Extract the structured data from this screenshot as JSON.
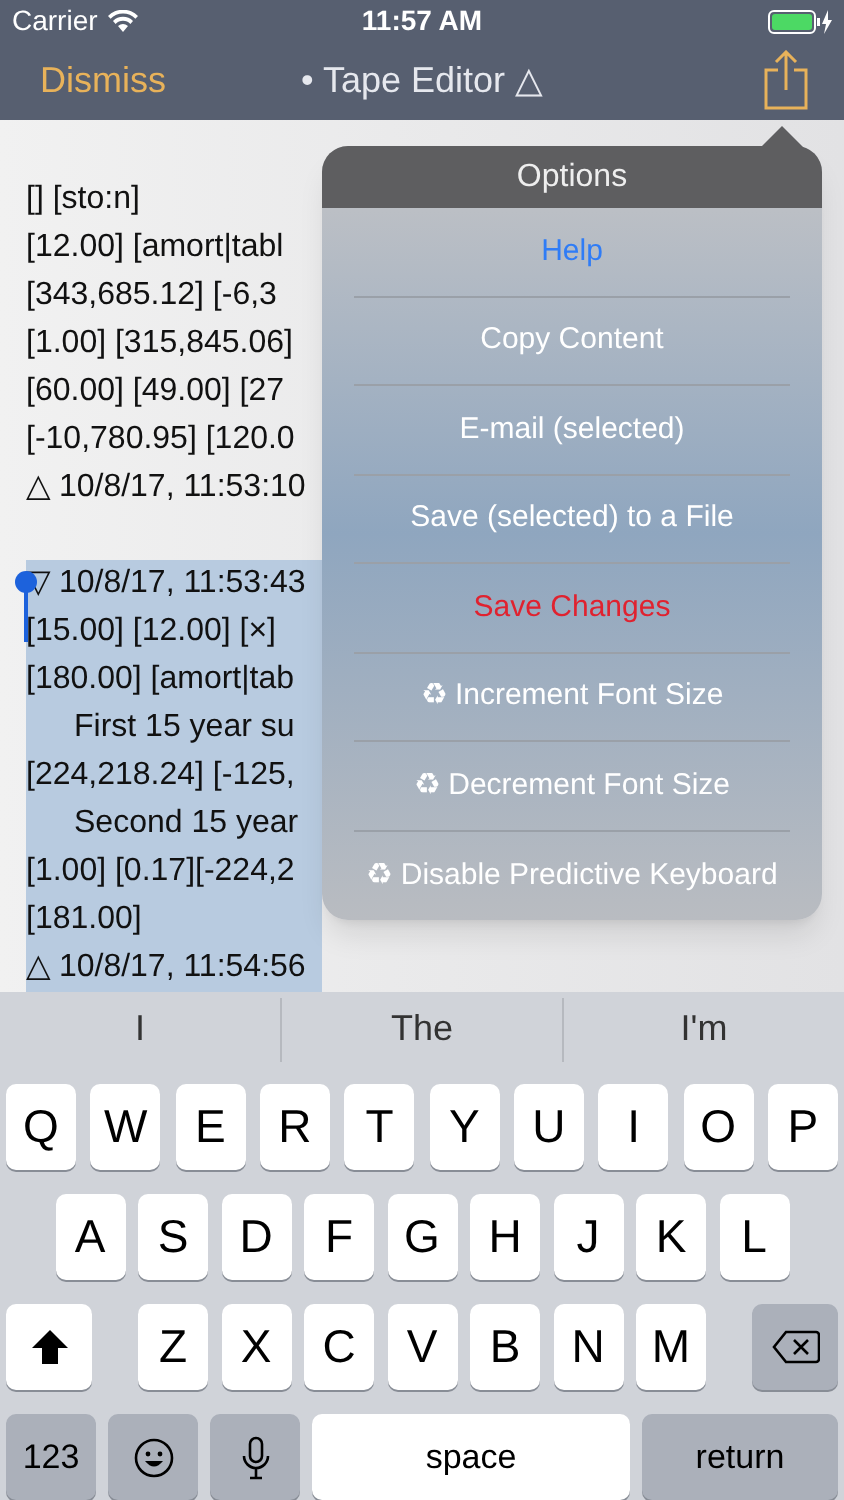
{
  "status_bar": {
    "carrier": "Carrier",
    "time": "11:57 AM"
  },
  "nav": {
    "dismiss": "Dismiss",
    "title": "• Tape Editor △"
  },
  "tape_lines": [
    {
      "text": "[] [sto:n]",
      "selected": false,
      "kind": "entry"
    },
    {
      "text": "[12.00] [amort|tabl",
      "selected": false,
      "kind": "entry"
    },
    {
      "text": "[343,685.12] [-6,3",
      "selected": false,
      "kind": "entry"
    },
    {
      "text": "[1.00] [315,845.06]",
      "selected": false,
      "kind": "entry"
    },
    {
      "text": "[60.00] [49.00] [27",
      "selected": false,
      "kind": "entry"
    },
    {
      "text": "[-10,780.95] [120.0",
      "selected": false,
      "kind": "entry"
    },
    {
      "text": "△ 10/8/17, 11:53:10",
      "selected": false,
      "kind": "entry"
    },
    {
      "selected": false,
      "kind": "blank"
    },
    {
      "text": "▽ 10/8/17, 11:53:43",
      "selected": true,
      "kind": "entry"
    },
    {
      "text": "[15.00] [12.00] [×]",
      "selected": true,
      "kind": "entry"
    },
    {
      "text": "[180.00] [amort|tab",
      "selected": true,
      "kind": "entry"
    },
    {
      "text": "First 15 year su",
      "selected": true,
      "kind": "note"
    },
    {
      "text": "[224,218.24] [-125,",
      "selected": true,
      "kind": "entry"
    },
    {
      "text": "Second 15 year",
      "selected": true,
      "kind": "note"
    },
    {
      "text": "[1.00] [0.17][-224,2",
      "selected": true,
      "kind": "entry"
    },
    {
      "text": "[181.00]",
      "selected": true,
      "kind": "entry"
    },
    {
      "text": "△ 10/8/17, 11:54:56",
      "selected": true,
      "kind": "entry"
    }
  ],
  "options_menu": {
    "title": "Options",
    "items": [
      {
        "label": "Help",
        "kind": "link"
      },
      {
        "label": "Copy Content",
        "kind": "plain"
      },
      {
        "label": "E-mail (selected)",
        "kind": "plain"
      },
      {
        "label": "Save (selected) to a File",
        "kind": "plain"
      },
      {
        "label": "Save Changes",
        "kind": "destructive"
      },
      {
        "label": "♻ Increment Font Size",
        "kind": "plain"
      },
      {
        "label": "♻ Decrement Font Size",
        "kind": "plain"
      },
      {
        "label": "♻ Disable Predictive Keyboard",
        "kind": "plain"
      }
    ]
  },
  "suggestions": [
    "I",
    "The",
    "I'm"
  ],
  "keyboard": {
    "rows": [
      [
        "Q",
        "W",
        "E",
        "R",
        "T",
        "Y",
        "U",
        "I",
        "O",
        "P"
      ],
      [
        "A",
        "S",
        "D",
        "F",
        "G",
        "H",
        "J",
        "K",
        "L"
      ],
      [
        "Z",
        "X",
        "C",
        "V",
        "B",
        "N",
        "M"
      ]
    ],
    "numbers": "123",
    "space": "space",
    "return": "return"
  }
}
